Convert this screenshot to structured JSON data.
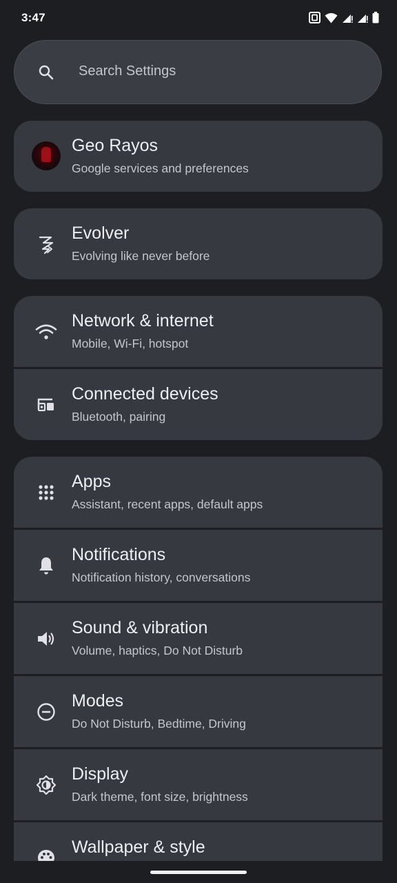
{
  "status_bar": {
    "time": "3:47"
  },
  "search": {
    "placeholder": "Search Settings"
  },
  "account": {
    "title": "Geo Rayos",
    "subtitle": "Google services and preferences"
  },
  "evolver": {
    "title": "Evolver",
    "subtitle": "Evolving like never before"
  },
  "connectivity": [
    {
      "title": "Network & internet",
      "subtitle": "Mobile, Wi-Fi, hotspot",
      "icon": "wifi-icon"
    },
    {
      "title": "Connected devices",
      "subtitle": "Bluetooth, pairing",
      "icon": "devices-icon"
    }
  ],
  "settings": [
    {
      "title": "Apps",
      "subtitle": "Assistant, recent apps, default apps",
      "icon": "apps-grid-icon"
    },
    {
      "title": "Notifications",
      "subtitle": "Notification history, conversations",
      "icon": "bell-icon"
    },
    {
      "title": "Sound & vibration",
      "subtitle": "Volume, haptics, Do Not Disturb",
      "icon": "speaker-icon"
    },
    {
      "title": "Modes",
      "subtitle": "Do Not Disturb, Bedtime, Driving",
      "icon": "minus-circle-icon"
    },
    {
      "title": "Display",
      "subtitle": "Dark theme, font size, brightness",
      "icon": "brightness-icon"
    },
    {
      "title": "Wallpaper & style",
      "subtitle": "",
      "icon": "palette-icon"
    }
  ],
  "colors": {
    "background": "#1c1e22",
    "card": "#363940",
    "search_bar": "#3a3d44",
    "text_primary": "#eceef2",
    "text_secondary": "#c4c6cc"
  }
}
